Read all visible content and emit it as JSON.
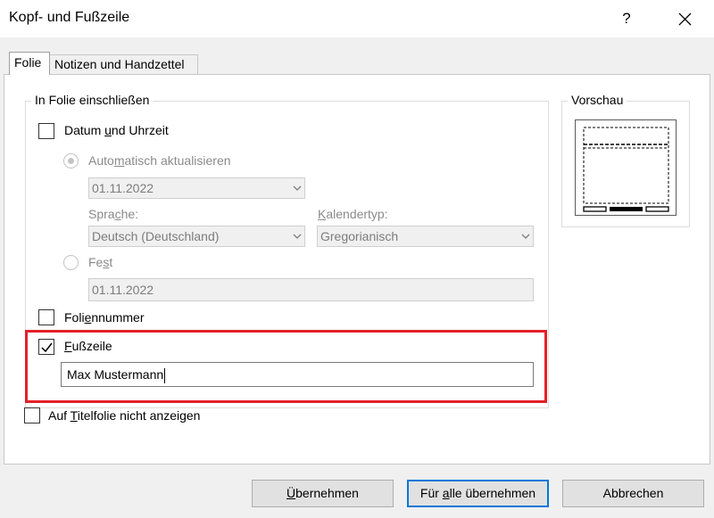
{
  "window": {
    "title": "Kopf- und Fußzeile",
    "help_label": "?"
  },
  "tabs": [
    {
      "label": "Folie",
      "active": true
    },
    {
      "label": "Notizen und Handzettel",
      "active": false
    }
  ],
  "group": {
    "label": "In Folie einschließen",
    "date_time": {
      "label_pre": "Datum ",
      "label_u": "u",
      "label_post": "nd Uhrzeit",
      "checked": false
    },
    "auto_update": {
      "label_pre": "Auto",
      "label_u": "m",
      "label_post": "atisch aktualisieren",
      "selected": true,
      "date_value": "01.11.2022"
    },
    "language": {
      "label_pre": "Spra",
      "label_u": "c",
      "label_post": "he:",
      "value": "Deutsch (Deutschland)"
    },
    "calendar": {
      "label_pre": "",
      "label_u": "K",
      "label_post": "alendertyp:",
      "value": "Gregorianisch"
    },
    "fixed": {
      "label_pre": "Fe",
      "label_u": "s",
      "label_post": "t",
      "selected": false,
      "value": "01.11.2022"
    },
    "slide_number": {
      "label_pre": "Foli",
      "label_u": "e",
      "label_post": "nnummer",
      "checked": false
    },
    "footer": {
      "label_pre": "",
      "label_u": "F",
      "label_post": "ußzeile",
      "checked": true,
      "value": "Max Mustermann"
    }
  },
  "hide_title": {
    "label_pre": "Auf ",
    "label_u": "T",
    "label_post": "itelfolie nicht anzeigen",
    "checked": false
  },
  "preview": {
    "label": "Vorschau"
  },
  "buttons": {
    "apply_pre": "",
    "apply_u": "Ü",
    "apply_post": "bernehmen",
    "apply_all_pre": "Für ",
    "apply_all_u": "a",
    "apply_all_post": "lle übernehmen",
    "cancel": "Abbrechen"
  },
  "colors": {
    "highlight": "#e3202a",
    "focus": "#0078d7"
  }
}
